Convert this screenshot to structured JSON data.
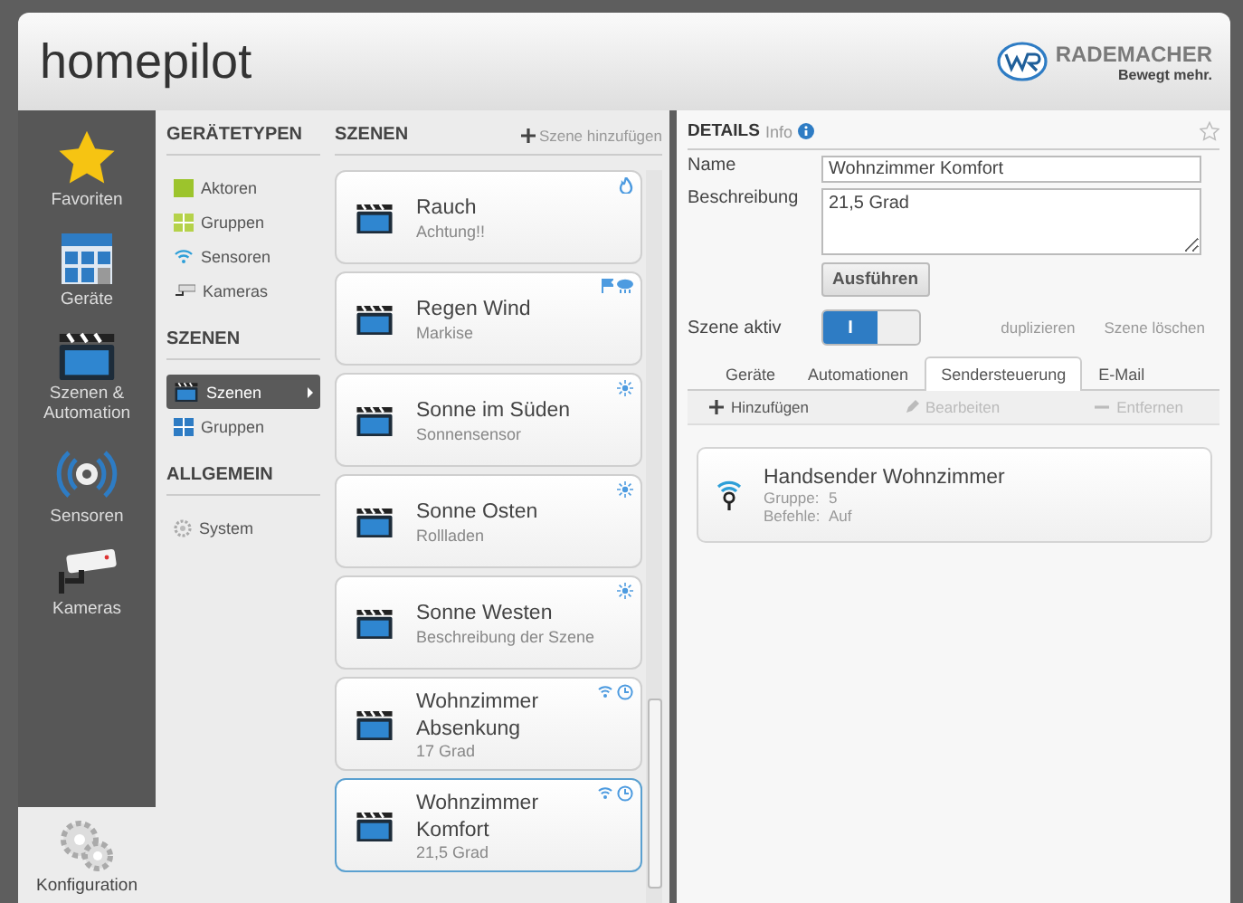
{
  "header": {
    "title": "homepilot",
    "brand": "RADEMACHER",
    "slogan": "Bewegt mehr."
  },
  "rail": {
    "items": [
      {
        "kind": "star",
        "label": "Favoriten"
      },
      {
        "kind": "building",
        "label": "Geräte"
      },
      {
        "kind": "clapper",
        "label": "Szenen & Automation"
      },
      {
        "kind": "sensor",
        "label": "Sensoren"
      },
      {
        "kind": "camera",
        "label": "Kameras"
      }
    ],
    "footer": {
      "label": "Konfiguration"
    }
  },
  "categories": [
    {
      "title": "GERÄTETYPEN",
      "items": [
        {
          "kind": "actuator",
          "label": "Aktoren",
          "selected": false
        },
        {
          "kind": "group-green",
          "label": "Gruppen",
          "selected": false
        },
        {
          "kind": "wifi",
          "label": "Sensoren",
          "selected": false
        },
        {
          "kind": "camera",
          "label": "Kameras",
          "selected": false
        }
      ]
    },
    {
      "title": "SZENEN",
      "items": [
        {
          "kind": "clapper",
          "label": "Szenen",
          "selected": true
        },
        {
          "kind": "group-blue",
          "label": "Gruppen",
          "selected": false
        }
      ]
    },
    {
      "title": "ALLGEMEIN",
      "items": [
        {
          "kind": "gear",
          "label": "System",
          "selected": false
        }
      ]
    }
  ],
  "scenes": {
    "title": "SZENEN",
    "add_label": "Szene hinzufügen",
    "items": [
      {
        "kind": "smoke",
        "title": "Rauch",
        "subtitle": "Achtung!!",
        "selected": false
      },
      {
        "kind": "weather",
        "title": "Regen Wind",
        "subtitle": "Markise",
        "selected": false
      },
      {
        "kind": "sun",
        "title": "Sonne im Süden",
        "subtitle": "Sonnensensor",
        "selected": false
      },
      {
        "kind": "sun",
        "title": "Sonne Osten",
        "subtitle": "Rollladen",
        "selected": false
      },
      {
        "kind": "sun",
        "title": "Sonne Westen",
        "subtitle": "Beschreibung der Szene",
        "selected": false
      },
      {
        "kind": "timer",
        "title": "Wohnzimmer Absenkung",
        "subtitle": "17 Grad",
        "selected": false
      },
      {
        "kind": "timer",
        "title": "Wohnzimmer Komfort",
        "subtitle": "21,5 Grad",
        "selected": true
      }
    ]
  },
  "details": {
    "title": "DETAILS",
    "info": "Info",
    "name_label": "Name",
    "name_value": "Wohnzimmer Komfort",
    "description_label": "Beschreibung",
    "description_value": "21,5 Grad",
    "run_button": "Ausführen",
    "active_label": "Szene aktiv",
    "active": true,
    "active_on_text": "I",
    "duplicate": "duplizieren",
    "delete": "Szene löschen",
    "tabs": [
      {
        "label": "Geräte",
        "selected": false
      },
      {
        "label": "Automationen",
        "selected": false
      },
      {
        "label": "Sendersteuerung",
        "selected": true
      },
      {
        "label": "E-Mail",
        "selected": false
      }
    ],
    "actions": [
      {
        "kind": "add",
        "label": "Hinzufügen",
        "disabled": false
      },
      {
        "kind": "edit",
        "label": "Bearbeiten",
        "disabled": true
      },
      {
        "kind": "remove",
        "label": "Entfernen",
        "disabled": true
      }
    ],
    "transmitters": [
      {
        "name": "Handsender Wohnzimmer",
        "group_label": "Gruppe:",
        "group": "5",
        "commands_label": "Befehle:",
        "commands": "Auf"
      }
    ]
  }
}
